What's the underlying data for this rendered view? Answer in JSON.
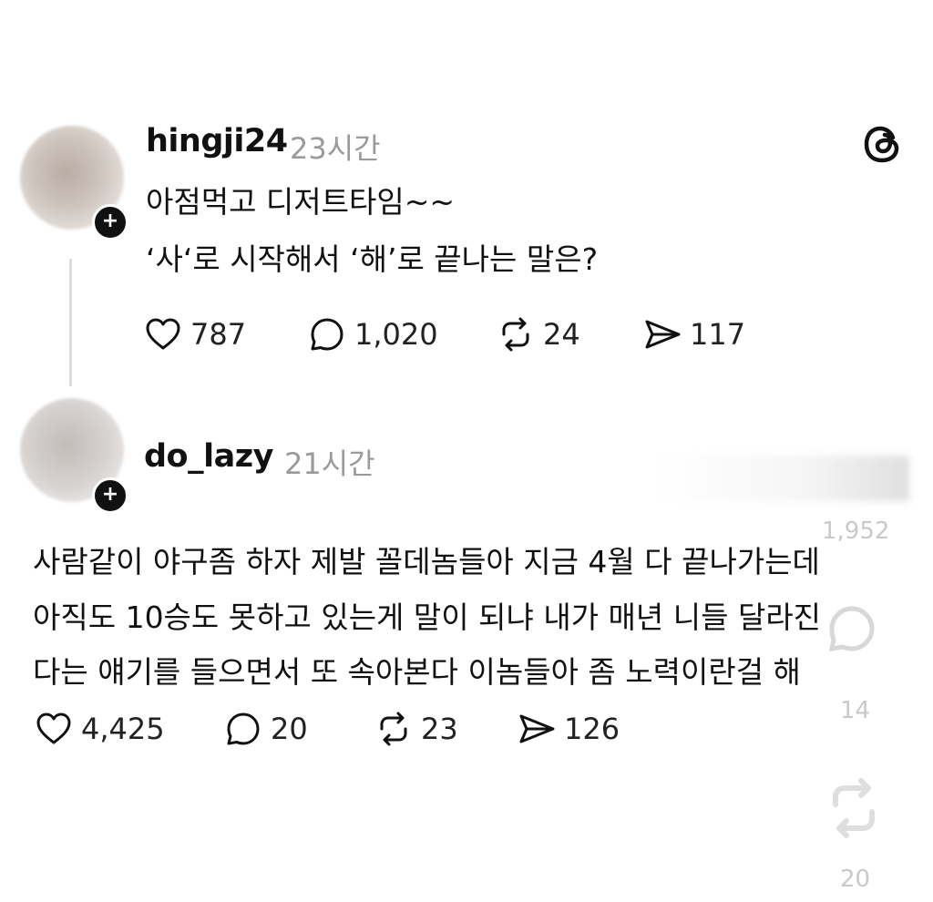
{
  "post1": {
    "username": "hingji24",
    "time": "23시간",
    "lines": [
      "아점먹고 디저트타임~~",
      "‘사‘로 시작해서 ‘해’로 끝나는 말은?"
    ],
    "actions": {
      "likes": "787",
      "replies": "1,020",
      "reposts": "24",
      "shares": "117"
    }
  },
  "post2": {
    "username": "do_lazy",
    "time": "21시간",
    "lines": [
      "사람같이 야구좀 하자 제발 꼴데놈들아 지금 4월 다 끝나가는데",
      "아직도 10승도 못하고 있는게 말이 되냐 내가 매년 니들 달라진",
      "다는 얘기를 들으면서 또 속아본다 이놈들아 좀 노력이란걸 해"
    ],
    "actions": {
      "likes": "4,425",
      "replies": "20",
      "reposts": "23",
      "shares": "126"
    }
  },
  "overlay": {
    "count_top": "1,952",
    "count_mid": "14",
    "count_bottom": "20"
  },
  "icons": {
    "like": "heart-icon",
    "reply": "comment-icon",
    "repost": "repost-icon",
    "share": "share-icon",
    "brand": "threads-logo-icon"
  }
}
